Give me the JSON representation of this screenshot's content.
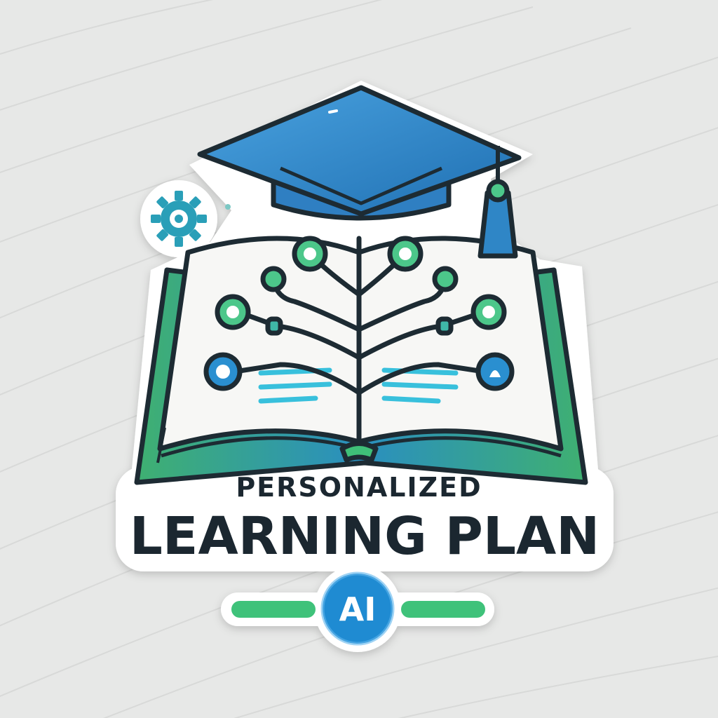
{
  "logo": {
    "line1": "PERSONALIZED",
    "line2": "LEARNING PLAN",
    "badge": "AI"
  },
  "icons": {
    "cap": "graduation-cap-icon",
    "book": "open-book-icon",
    "tree": "circuit-tree-icon",
    "gear": "gear-icon"
  },
  "colors": {
    "background": "#e6e7e6",
    "outline": "#1d2b33",
    "cap_blue": "#2f86c6",
    "book_green": "#4cbf7a",
    "accent_teal": "#2aa6b8",
    "badge_blue": "#1f8bd2",
    "text": "#1b2730"
  }
}
